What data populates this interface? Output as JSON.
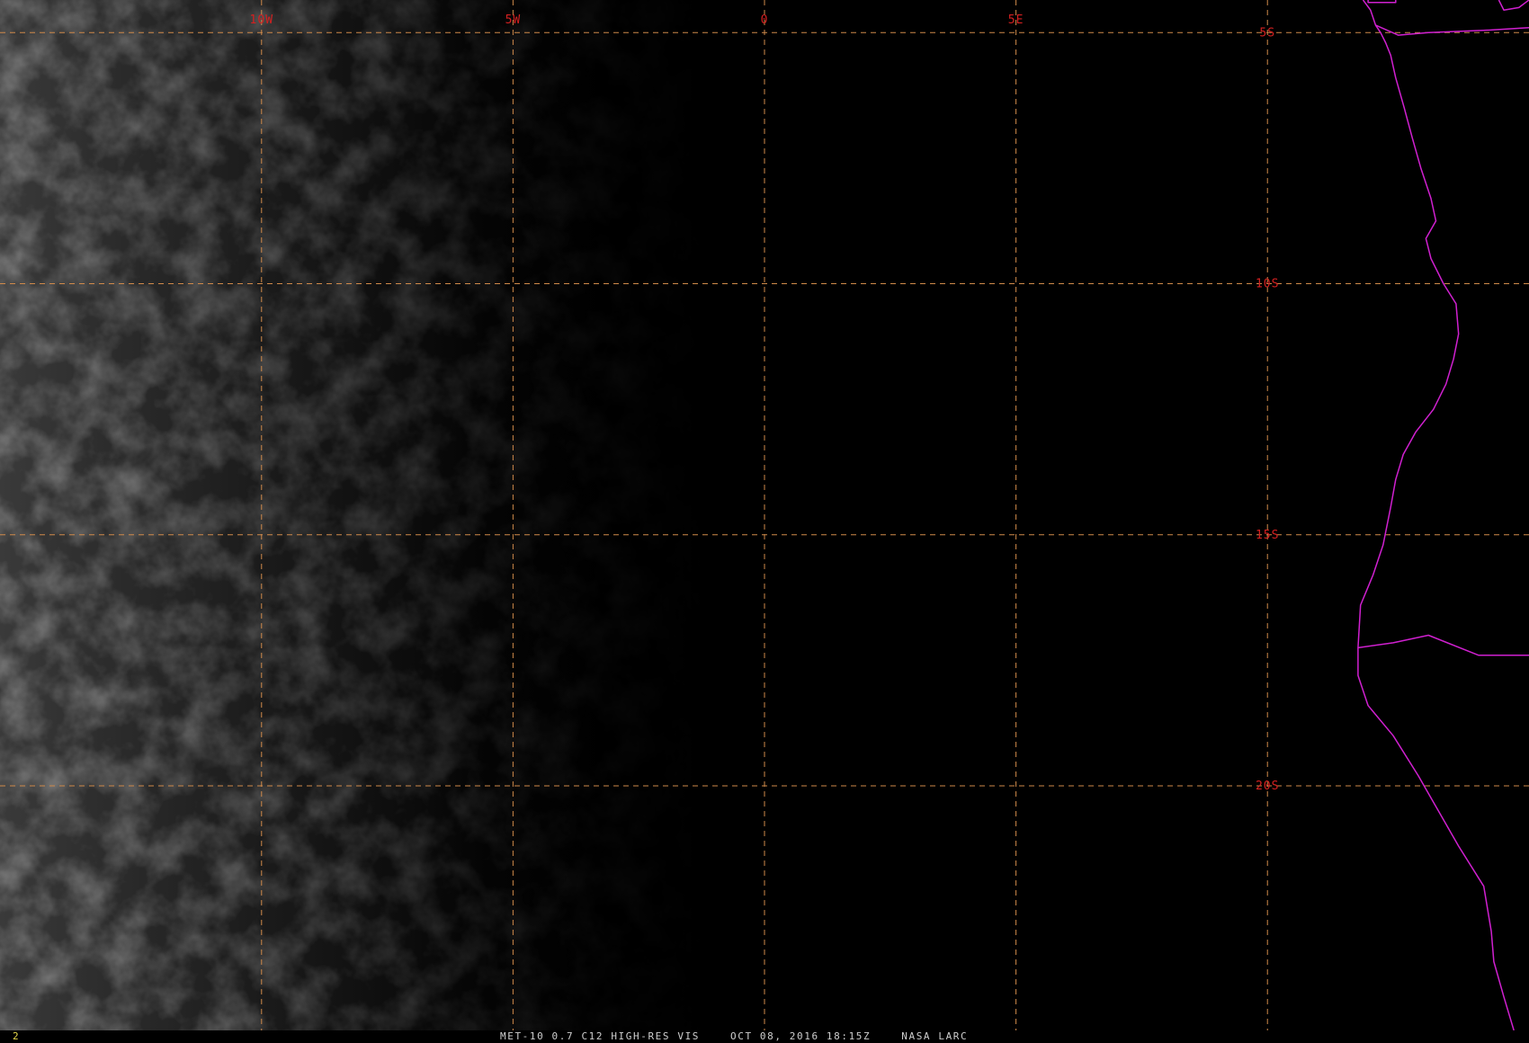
{
  "image": {
    "caption": {
      "sensor": "MET-10 0.7 C12 HIGH-RES VIS",
      "datetime": "OCT 08, 2016 18:15Z",
      "source": "NASA LARC"
    },
    "frame_number": "2"
  },
  "grid": {
    "longitudes": [
      {
        "value": -10,
        "label": "10W"
      },
      {
        "value": -5,
        "label": "5W"
      },
      {
        "value": 0,
        "label": "0"
      },
      {
        "value": 5,
        "label": "5E"
      },
      {
        "value": 10,
        "label": ""
      }
    ],
    "latitudes": [
      {
        "value": -5,
        "label": "5S"
      },
      {
        "value": -10,
        "label": "10S"
      },
      {
        "value": -15,
        "label": "15S"
      },
      {
        "value": -20,
        "label": "20S"
      },
      {
        "value": -25,
        "label": ""
      }
    ],
    "extent": {
      "lon_min": -15.2,
      "lon_max": 15.2,
      "lat_max": -4.35,
      "lat_min": -24.87
    },
    "colors": {
      "gridline": "#d08a4a",
      "latlon_label": "#d42020",
      "political_boundary": "#d020d0",
      "background": "#000000"
    }
  },
  "coastline": {
    "name": "political-boundary",
    "points": [
      [
        11.9,
        -4.35
      ],
      [
        12.05,
        -4.55
      ],
      [
        12.15,
        -4.85
      ],
      [
        12.25,
        -5.0
      ],
      [
        12.35,
        -5.2
      ],
      [
        12.45,
        -5.45
      ],
      [
        12.55,
        -5.9
      ],
      [
        12.72,
        -6.5
      ],
      [
        12.88,
        -7.1
      ],
      [
        13.05,
        -7.7
      ],
      [
        13.25,
        -8.3
      ],
      [
        13.35,
        -8.75
      ],
      [
        13.15,
        -9.1
      ],
      [
        13.25,
        -9.5
      ],
      [
        13.5,
        -10.0
      ],
      [
        13.75,
        -10.4
      ],
      [
        13.8,
        -11.0
      ],
      [
        13.7,
        -11.5
      ],
      [
        13.55,
        -12.0
      ],
      [
        13.3,
        -12.5
      ],
      [
        12.95,
        -12.95
      ],
      [
        12.7,
        -13.4
      ],
      [
        12.55,
        -13.9
      ],
      [
        12.45,
        -14.45
      ],
      [
        12.3,
        -15.2
      ],
      [
        12.1,
        -15.8
      ],
      [
        11.85,
        -16.4
      ],
      [
        11.8,
        -17.25
      ],
      [
        11.8,
        -17.8
      ],
      [
        12.0,
        -18.4
      ],
      [
        12.5,
        -19.0
      ],
      [
        13.0,
        -19.8
      ],
      [
        13.4,
        -20.5
      ],
      [
        13.8,
        -21.2
      ],
      [
        14.3,
        -22.0
      ],
      [
        14.45,
        -22.9
      ],
      [
        14.5,
        -23.5
      ],
      [
        14.7,
        -24.2
      ],
      [
        14.9,
        -24.87
      ]
    ],
    "borders": [
      {
        "name": "angola-namibia-border",
        "points": [
          [
            11.8,
            -17.25
          ],
          [
            12.5,
            -17.15
          ],
          [
            13.2,
            -17.0
          ],
          [
            14.2,
            -17.4
          ],
          [
            15.2,
            -17.4
          ]
        ]
      },
      {
        "name": "congo-angola-border",
        "points": [
          [
            12.15,
            -4.85
          ],
          [
            12.6,
            -5.05
          ],
          [
            13.2,
            -5.0
          ],
          [
            14.4,
            -4.95
          ],
          [
            15.2,
            -4.9
          ]
        ]
      },
      {
        "name": "cabinda-border",
        "points": [
          [
            12.0,
            -4.35
          ],
          [
            12.0,
            -4.4
          ],
          [
            12.55,
            -4.4
          ],
          [
            12.55,
            -4.35
          ]
        ]
      },
      {
        "name": "drc-border",
        "points": [
          [
            14.6,
            -4.35
          ],
          [
            14.7,
            -4.55
          ],
          [
            15.0,
            -4.5
          ],
          [
            15.2,
            -4.35
          ]
        ]
      }
    ]
  }
}
